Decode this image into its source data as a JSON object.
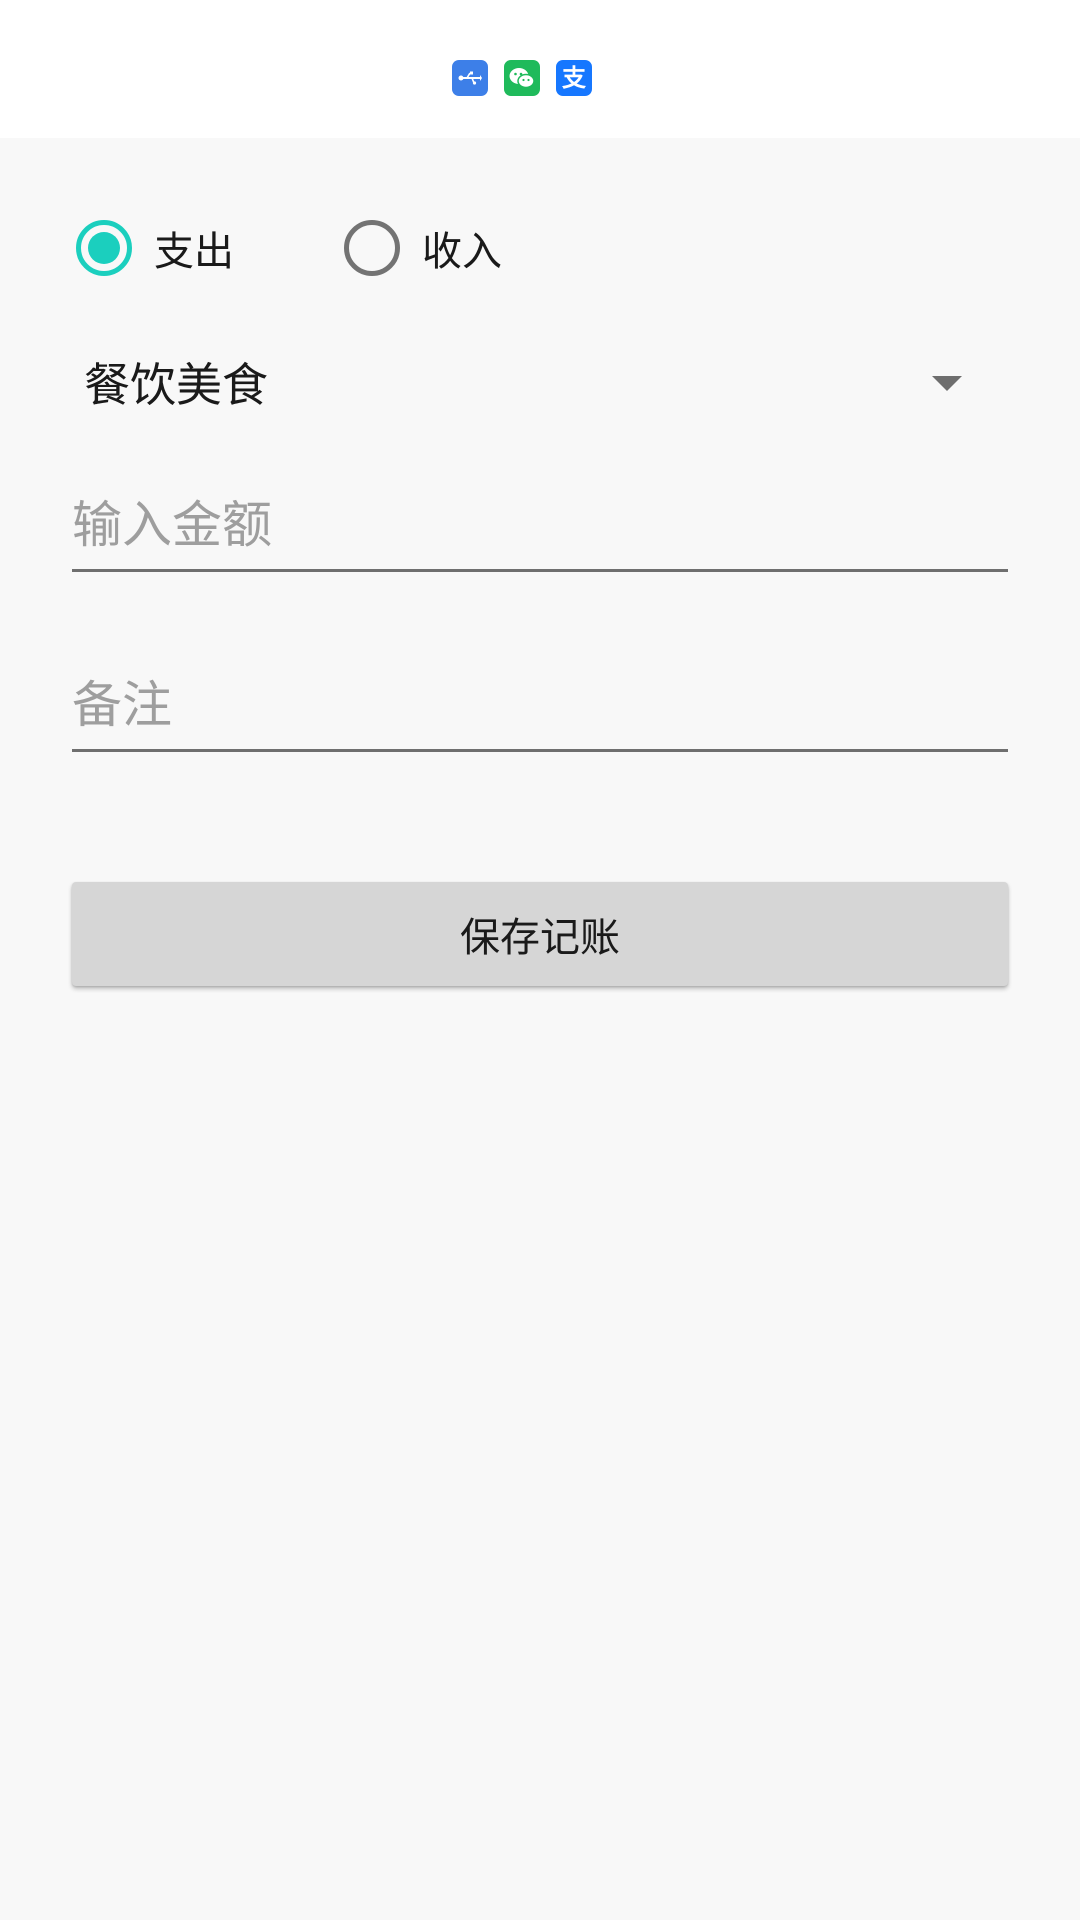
{
  "colors": {
    "accent": "#1bcfbe",
    "usb_icon_bg": "#3d7fe8",
    "wechat_icon_bg": "#1fba5b",
    "alipay_icon_bg": "#1677ff"
  },
  "status_bar": {
    "notification_icons": [
      {
        "name": "usb-icon",
        "glyph": "⭠"
      },
      {
        "name": "wechat-icon",
        "glyph": "●"
      },
      {
        "name": "alipay-icon",
        "glyph": "支"
      }
    ]
  },
  "form": {
    "type_options": [
      {
        "label": "支出",
        "checked": true
      },
      {
        "label": "收入",
        "checked": false
      }
    ],
    "category": {
      "selected": "餐饮美食",
      "icon": "dropdown-arrow-icon"
    },
    "amount": {
      "value": "",
      "placeholder": "输入金额"
    },
    "note": {
      "value": "",
      "placeholder": "备注"
    },
    "save_label": "保存记账"
  }
}
